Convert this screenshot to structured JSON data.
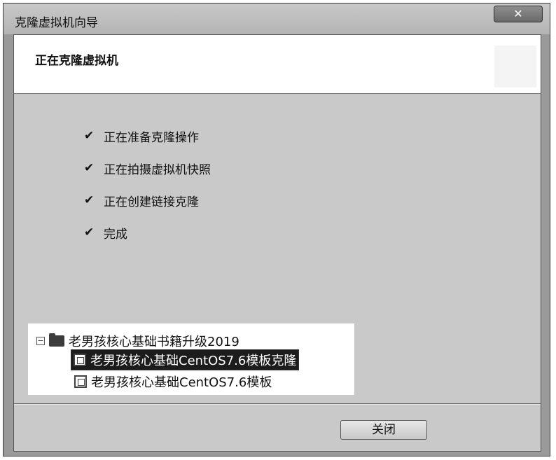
{
  "window": {
    "title": "克隆虚拟机向导",
    "close_glyph": "✕"
  },
  "header": {
    "title": "正在克隆虚拟机"
  },
  "steps": [
    {
      "check": "✔",
      "label": "正在准备克隆操作"
    },
    {
      "check": "✔",
      "label": "正在拍摄虚拟机快照"
    },
    {
      "check": "✔",
      "label": "正在创建链接克隆"
    },
    {
      "check": "✔",
      "label": "完成"
    }
  ],
  "tree": {
    "folder_expander": "−",
    "folder_label": "老男孩核心基础书籍升级2019",
    "items": [
      {
        "label": "老男孩核心基础CentOS7.6模板克隆",
        "selected": true
      },
      {
        "label": "老男孩核心基础CentOS7.6模板",
        "selected": false
      }
    ]
  },
  "footer": {
    "close_label": "关闭"
  },
  "icons": {
    "title_close": "close-icon",
    "check": "checkmark-icon",
    "folder": "folder-icon",
    "vm": "virtual-machine-icon"
  }
}
